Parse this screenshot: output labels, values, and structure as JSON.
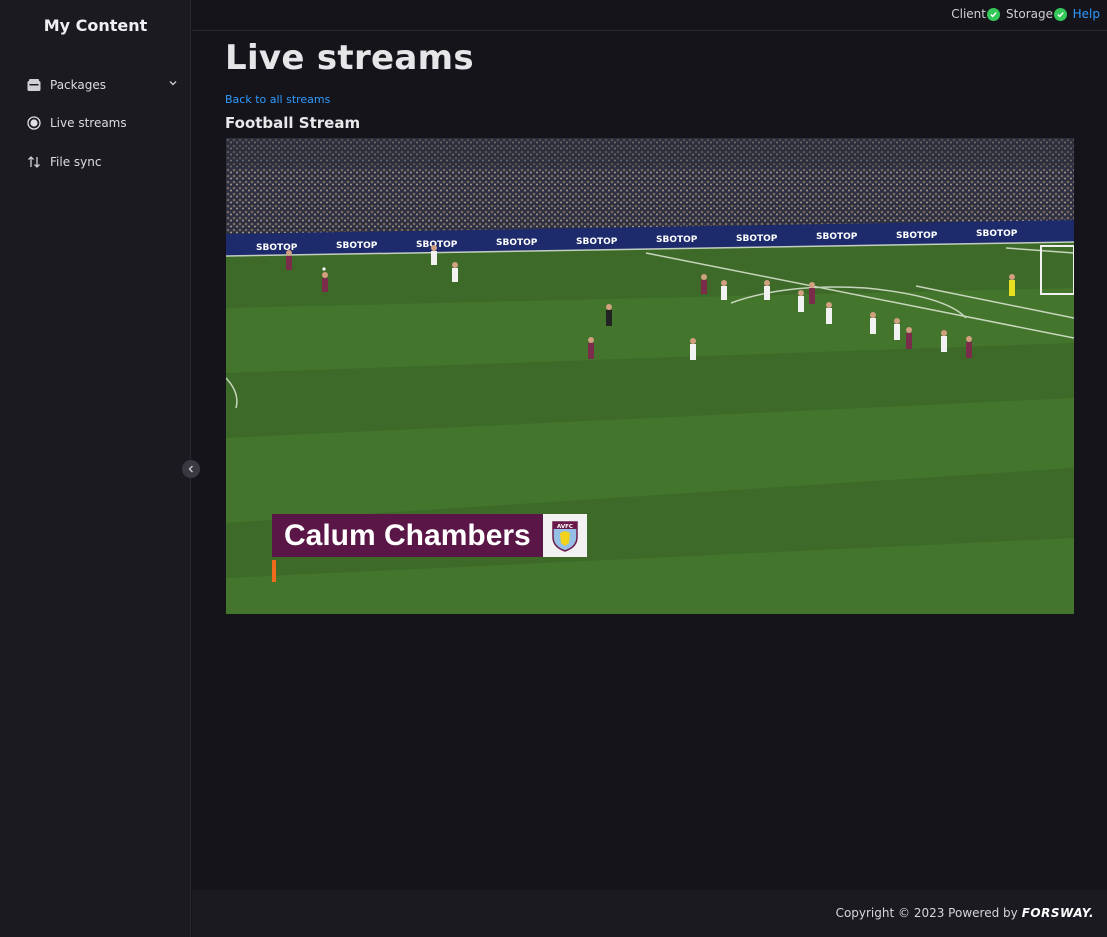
{
  "sidebar": {
    "title": "My Content",
    "items": [
      {
        "label": "Packages",
        "icon": "package-icon",
        "expandable": true
      },
      {
        "label": "Live streams",
        "icon": "live-icon",
        "active": true
      },
      {
        "label": "File sync",
        "icon": "sync-icon"
      }
    ]
  },
  "topbar": {
    "client_label": "Client",
    "storage_label": "Storage",
    "help_label": "Help"
  },
  "main": {
    "title": "Live streams",
    "back_label": "Back to all streams",
    "stream_title": "Football Stream",
    "video": {
      "lower_third_name": "Calum Chambers",
      "crest_text": "AVFC",
      "ad_board_text": "SBOTOP"
    }
  },
  "footer": {
    "copyright": "Copyright © 2023 Powered by",
    "brand": "FORSWAY."
  },
  "colors": {
    "accent": "#2f9bff",
    "status_ok": "#34c759",
    "background": "#15141b",
    "sidebar": "#1b1a21",
    "lower_third": "#5a1646"
  }
}
